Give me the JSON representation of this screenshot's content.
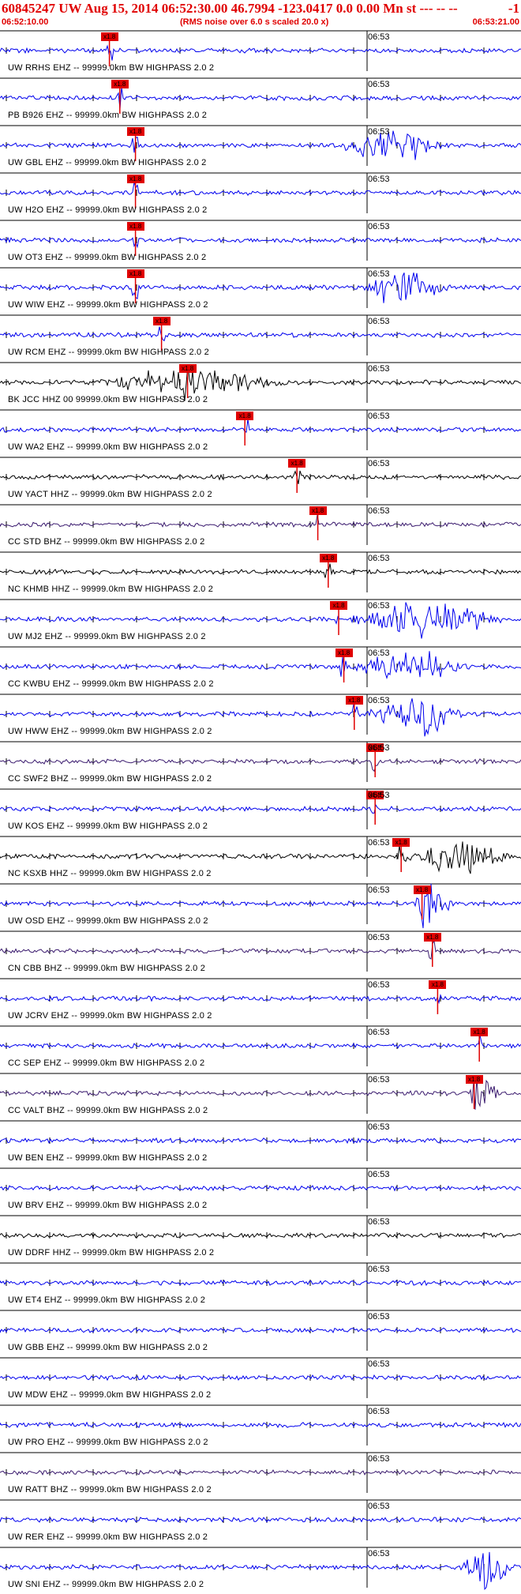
{
  "header": {
    "title": "60845247 UW Aug 15, 2014 06:52:30.00   46.7994 -123.0417  0.0 0.00 Mn st --- -- --",
    "right_mark": "-1",
    "start_time": "06:52:10.00",
    "subtitle": "(RMS noise over 6.0 s scaled 20.0 x)",
    "end_time": "06:53:21.00"
  },
  "time_tick_label": "06:53",
  "pick_label": "x1.8",
  "colors": {
    "header_red": "#e00000",
    "pick_red": "#e00000",
    "blue": "#0000ee",
    "black": "#000000",
    "purple": "#3a1a6e"
  },
  "traces": [
    {
      "label": "UW RRHS EHZ -- 99999.0km BW  HIGHPASS  2.0  2",
      "color": "blue",
      "pick": 0.21,
      "burst": []
    },
    {
      "label": "PB B926 EHZ -- 99999.0km BW  HIGHPASS  2.0  2",
      "color": "blue",
      "pick": 0.23,
      "burst": []
    },
    {
      "label": "UW GBL EHZ -- 99999.0km BW  HIGHPASS  2.0  2",
      "color": "blue",
      "pick": 0.26,
      "burst": [
        [
          0.64,
          0.86,
          6
        ]
      ]
    },
    {
      "label": "UW H2O EHZ -- 99999.0km BW  HIGHPASS  2.0  2",
      "color": "blue",
      "pick": 0.26,
      "burst": []
    },
    {
      "label": "UW OT3 EHZ -- 99999.0km BW  HIGHPASS  2.0  2",
      "color": "blue",
      "pick": 0.26,
      "burst": []
    },
    {
      "label": "UW WIW EHZ -- 99999.0km BW  HIGHPASS  2.0  2",
      "color": "blue",
      "pick": 0.26,
      "burst": [
        [
          0.68,
          0.87,
          7
        ]
      ]
    },
    {
      "label": "UW RCM EHZ -- 99999.0km BW  HIGHPASS  2.0  2",
      "color": "blue",
      "pick": 0.31,
      "burst": []
    },
    {
      "label": "BK JCC HHZ 00 99999.0km BW  HIGHPASS  2.0  2",
      "color": "black",
      "pick": 0.36,
      "burst": [
        [
          0.18,
          0.56,
          5
        ]
      ]
    },
    {
      "label": "UW WA2 EHZ -- 99999.0km BW  HIGHPASS  2.0  2",
      "color": "blue",
      "pick": 0.47,
      "burst": []
    },
    {
      "label": "UW YACT HHZ -- 99999.0km BW  HIGHPASS  2.0  2",
      "color": "black",
      "pick": 0.57,
      "burst": []
    },
    {
      "label": "CC STD BHZ -- 99999.0km BW  HIGHPASS  2.0  2",
      "color": "purple",
      "pick": 0.61,
      "burst": []
    },
    {
      "label": "NC KHMB HHZ -- 99999.0km BW  HIGHPASS  2.0  2",
      "color": "black",
      "pick": 0.63,
      "burst": []
    },
    {
      "label": "UW MJ2 EHZ -- 99999.0km BW  HIGHPASS  2.0  2",
      "color": "blue",
      "pick": 0.65,
      "burst": [
        [
          0.66,
          0.97,
          7
        ]
      ]
    },
    {
      "label": "CC KWBU EHZ -- 99999.0km BW  HIGHPASS  2.0  2",
      "color": "blue",
      "pick": 0.66,
      "burst": [
        [
          0.66,
          0.9,
          6
        ]
      ]
    },
    {
      "label": "UW HWW EHZ -- 99999.0km BW  HIGHPASS  2.0  2",
      "color": "blue",
      "pick": 0.68,
      "burst": [
        [
          0.7,
          0.9,
          7
        ]
      ]
    },
    {
      "label": "CC SWF2 BHZ -- 99999.0km BW  HIGHPASS  2.0  2",
      "color": "purple",
      "pick": 0.72,
      "burst": []
    },
    {
      "label": "UW KOS EHZ -- 99999.0km BW  HIGHPASS  2.0  2",
      "color": "blue",
      "pick": 0.72,
      "burst": []
    },
    {
      "label": "NC KSXB HHZ -- 99999.0km BW  HIGHPASS  2.0  2",
      "color": "black",
      "pick": 0.77,
      "burst": [
        [
          0.76,
          0.99,
          6
        ]
      ]
    },
    {
      "label": "UW OSD EHZ -- 99999.0km BW  HIGHPASS  2.0  2",
      "color": "blue",
      "pick": 0.81,
      "burst": [
        [
          0.79,
          0.87,
          8
        ]
      ]
    },
    {
      "label": "CN CBB BHZ -- 99999.0km BW  HIGHPASS  2.0  2",
      "color": "purple",
      "pick": 0.83,
      "burst": []
    },
    {
      "label": "UW JCRV EHZ -- 99999.0km BW  HIGHPASS  2.0  2",
      "color": "blue",
      "pick": 0.84,
      "burst": []
    },
    {
      "label": "CC SEP EHZ -- 99999.0km BW  HIGHPASS  2.0  2",
      "color": "blue",
      "pick": 0.92,
      "burst": []
    },
    {
      "label": "CC VALT BHZ -- 99999.0km BW  HIGHPASS  2.0  2",
      "color": "purple",
      "pick": 0.91,
      "burst": [
        [
          0.9,
          0.96,
          6
        ]
      ]
    },
    {
      "label": "UW BEN EHZ -- 99999.0km BW  HIGHPASS  2.0  2",
      "color": "blue",
      "pick": null,
      "burst": []
    },
    {
      "label": "UW BRV EHZ -- 99999.0km BW  HIGHPASS  2.0  2",
      "color": "blue",
      "pick": null,
      "burst": []
    },
    {
      "label": "UW DDRF HHZ -- 99999.0km BW  HIGHPASS  2.0  2",
      "color": "black",
      "pick": null,
      "burst": []
    },
    {
      "label": "UW ET4 EHZ -- 99999.0km BW  HIGHPASS  2.0  2",
      "color": "blue",
      "pick": null,
      "burst": []
    },
    {
      "label": "UW GBB EHZ -- 99999.0km BW  HIGHPASS  2.0  2",
      "color": "blue",
      "pick": null,
      "burst": []
    },
    {
      "label": "UW MDW EHZ -- 99999.0km BW  HIGHPASS  2.0  2",
      "color": "blue",
      "pick": null,
      "burst": []
    },
    {
      "label": "UW PRO EHZ -- 99999.0km BW  HIGHPASS  2.0  2",
      "color": "blue",
      "pick": null,
      "burst": []
    },
    {
      "label": "UW RATT BHZ -- 99999.0km BW  HIGHPASS  2.0  2",
      "color": "purple",
      "pick": null,
      "burst": []
    },
    {
      "label": "UW RER EHZ -- 99999.0km BW  HIGHPASS  2.0  2",
      "color": "blue",
      "pick": null,
      "burst": []
    },
    {
      "label": "UW SNI EHZ -- 99999.0km BW  HIGHPASS  2.0  2",
      "color": "blue",
      "pick": null,
      "burst": [
        [
          0.88,
          0.99,
          8
        ]
      ]
    }
  ]
}
